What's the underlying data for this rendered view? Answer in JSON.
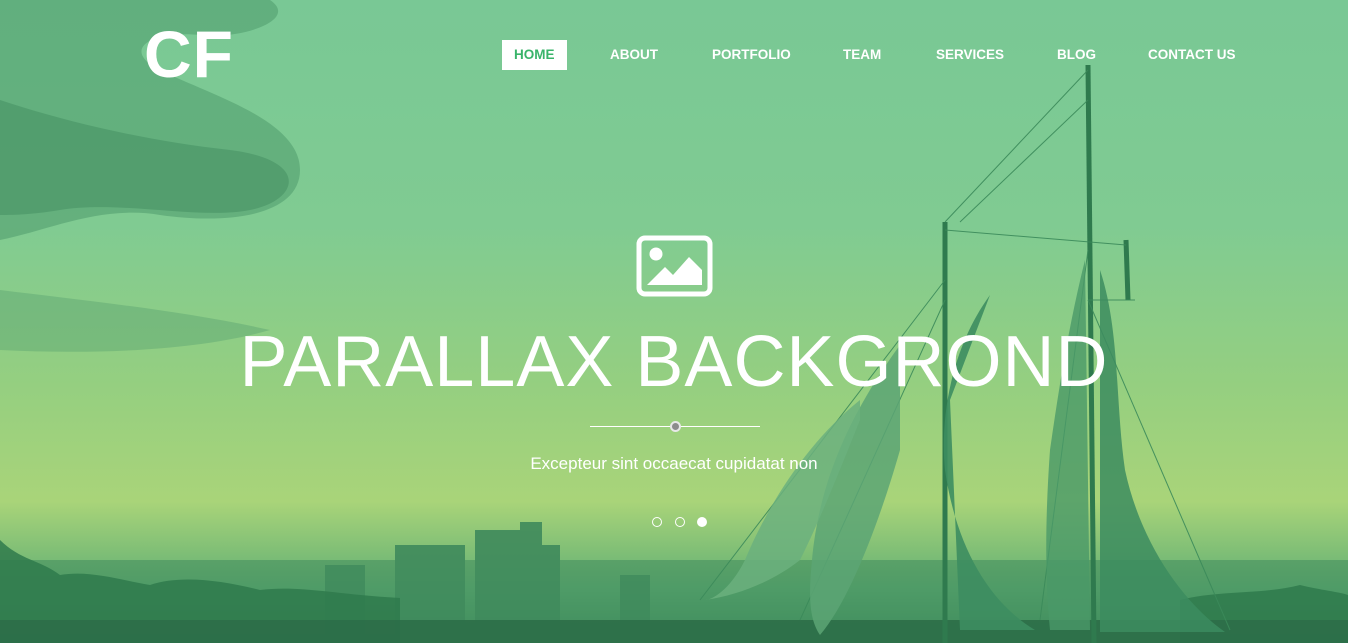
{
  "brand": {
    "logo": "CF"
  },
  "nav": {
    "items": [
      {
        "label": "HOME",
        "active": true
      },
      {
        "label": "ABOUT",
        "active": false
      },
      {
        "label": "PORTFOLIO",
        "active": false
      },
      {
        "label": "TEAM",
        "active": false
      },
      {
        "label": "SERVICES",
        "active": false
      },
      {
        "label": "BLOG",
        "active": false
      },
      {
        "label": "CONTACT US",
        "active": false
      }
    ]
  },
  "hero": {
    "icon": "image-icon",
    "title": "PARALLAX BACKGROND",
    "subtitle": "Excepteur sint occaecat cupidatat non",
    "slider": {
      "count": 3,
      "active_index": 3
    }
  },
  "colors": {
    "overlay_green": "#7cc993",
    "accent": "#39b46a",
    "text": "#ffffff"
  }
}
